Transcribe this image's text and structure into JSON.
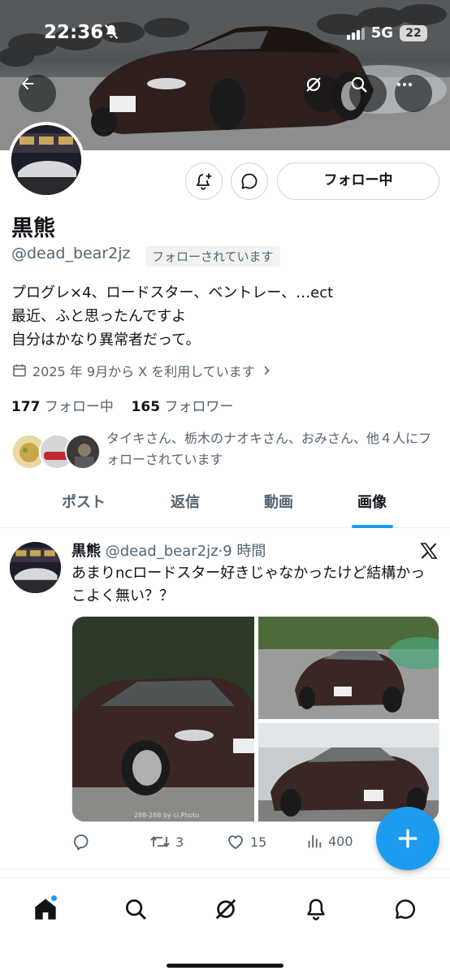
{
  "status_bar": {
    "time": "22:36",
    "network": "5G",
    "battery": "22"
  },
  "profile": {
    "name": "黒熊",
    "handle": "@dead_bear2jz",
    "follows_you_badge": "フォローされています",
    "follow_button_label": "フォロー中",
    "bio_lines": [
      "プログレ×4、ロードスター、ベントレー、…ect",
      "最近、ふと思ったんですよ",
      "自分はかなり異常者だって。"
    ],
    "joined": "2025 年 9月から X を利用しています",
    "following_count": "177",
    "following_label": "フォロー中",
    "followers_count": "165",
    "followers_label": "フォロワー",
    "mutual_followers_text": "タイキさん、栃木のナオキさん、おみさん、他４人にフォローされています"
  },
  "tabs": [
    {
      "label": "ポスト",
      "active": false
    },
    {
      "label": "返信",
      "active": false
    },
    {
      "label": "動画",
      "active": false
    },
    {
      "label": "画像",
      "active": true
    }
  ],
  "post": {
    "author_name": "黒熊",
    "author_handle": "@dead_bear2jz",
    "time_ago": "·9 時間",
    "text": "あまりncロードスター好きじゃなかったけど結構かっこよく無い？？",
    "reposts": "3",
    "likes": "15",
    "views": "400",
    "photo_watermark": "288-288 by ci.Photo"
  },
  "colors": {
    "accent": "#1d9bf0",
    "text_primary": "#0f1419",
    "text_secondary": "#536471",
    "car_body": "#3a2622"
  },
  "icons": [
    "back-arrow-icon",
    "grok-icon",
    "search-icon",
    "more-icon",
    "notification-bell-plus-icon",
    "message-icon",
    "calendar-icon",
    "chevron-right-icon",
    "x-logo-icon",
    "reply-icon",
    "repost-icon",
    "like-icon",
    "views-icon",
    "compose-plus-icon",
    "home-icon",
    "bell-icon",
    "messages-icon"
  ]
}
